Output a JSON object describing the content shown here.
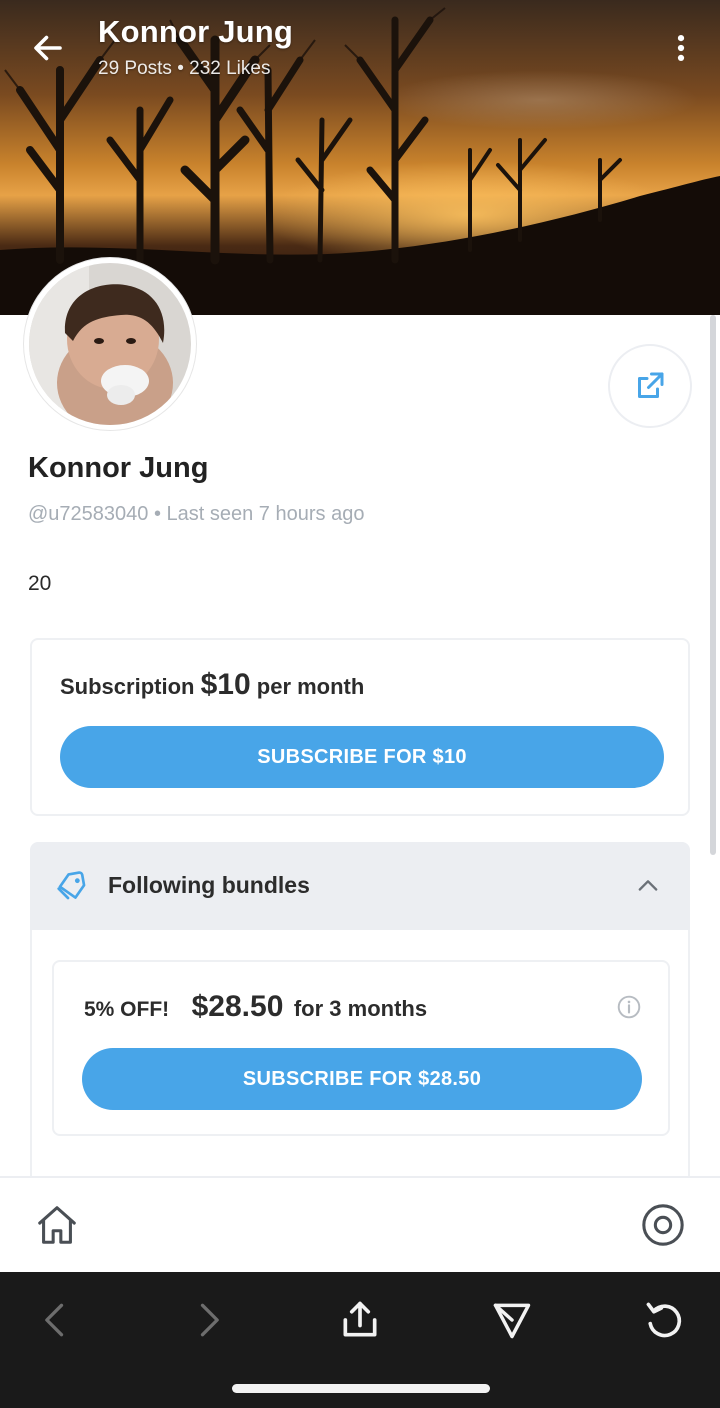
{
  "header": {
    "name": "Konnor Jung",
    "stats": "29 Posts • 232 Likes"
  },
  "profile": {
    "name": "Konnor Jung",
    "handle_line": "@u72583040 • Last seen 7 hours ago",
    "bio": "20"
  },
  "subscription": {
    "label": "Subscription",
    "price": "$10",
    "period": "per month",
    "button": "SUBSCRIBE FOR $10"
  },
  "bundles": {
    "title": "Following bundles",
    "items": [
      {
        "discount": "5% OFF!",
        "price": "$28.50",
        "period": "for 3 months",
        "button": "SUBSCRIBE FOR $28.50"
      }
    ]
  },
  "colors": {
    "accent": "#48a5e8",
    "muted_text": "#a6adb5",
    "header_bg": "#eceef2",
    "browser_bar": "#1a1a1a"
  },
  "icons": {
    "back": "arrow-left-icon",
    "more": "more-vertical-icon",
    "share": "share-icon",
    "bundles": "tag-icon",
    "collapse": "chevron-up-icon",
    "info": "info-icon",
    "home": "home-icon",
    "profile": "profile-icon",
    "browser_back": "chevron-left-icon",
    "browser_forward": "chevron-right-icon",
    "browser_share": "upload-icon",
    "browser_send": "send-icon",
    "browser_reload": "reload-icon"
  }
}
